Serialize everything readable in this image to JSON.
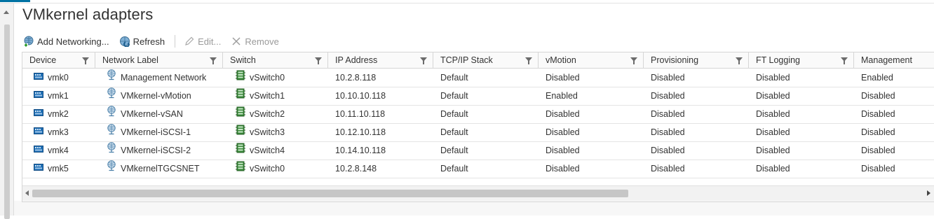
{
  "title": "VMkernel adapters",
  "toolbar": {
    "add_networking": "Add Networking...",
    "refresh": "Refresh",
    "edit": "Edit...",
    "remove": "Remove"
  },
  "columns": [
    "Device",
    "Network Label",
    "Switch",
    "IP Address",
    "TCP/IP Stack",
    "vMotion",
    "Provisioning",
    "FT Logging",
    "Management"
  ],
  "rows": [
    {
      "device": "vmk0",
      "label": "Management Network",
      "switch": "vSwitch0",
      "ip": "10.2.8.118",
      "stack": "Default",
      "vmotion": "Disabled",
      "provisioning": "Disabled",
      "ft": "Disabled",
      "management": "Enabled"
    },
    {
      "device": "vmk1",
      "label": "VMkernel-vMotion",
      "switch": "vSwitch1",
      "ip": "10.10.10.118",
      "stack": "Default",
      "vmotion": "Enabled",
      "provisioning": "Disabled",
      "ft": "Disabled",
      "management": "Disabled"
    },
    {
      "device": "vmk2",
      "label": "VMkernel-vSAN",
      "switch": "vSwitch2",
      "ip": "10.11.10.118",
      "stack": "Default",
      "vmotion": "Disabled",
      "provisioning": "Disabled",
      "ft": "Disabled",
      "management": "Disabled"
    },
    {
      "device": "vmk3",
      "label": "VMkernel-iSCSI-1",
      "switch": "vSwitch3",
      "ip": "10.12.10.118",
      "stack": "Default",
      "vmotion": "Disabled",
      "provisioning": "Disabled",
      "ft": "Disabled",
      "management": "Disabled"
    },
    {
      "device": "vmk4",
      "label": "VMkernel-iSCSI-2",
      "switch": "vSwitch4",
      "ip": "10.14.10.118",
      "stack": "Default",
      "vmotion": "Disabled",
      "provisioning": "Disabled",
      "ft": "Disabled",
      "management": "Disabled"
    },
    {
      "device": "vmk5",
      "label": "VMkernelTGCSNET",
      "switch": "vSwitch0",
      "ip": "10.2.8.148",
      "stack": "Default",
      "vmotion": "Disabled",
      "provisioning": "Disabled",
      "ft": "Disabled",
      "management": "Disabled"
    }
  ],
  "icons": {
    "add_networking": "add-network-icon",
    "refresh": "refresh-icon",
    "edit": "pencil-icon",
    "remove": "close-icon",
    "device": "nic-adapter-icon",
    "label": "network-globe-icon",
    "switch": "virtual-switch-icon",
    "filter": "filter-icon"
  },
  "colors": {
    "accent": "#0072a3",
    "device_icon": "#1f6fb5",
    "switch_icon": "#3a8a3a",
    "globe_icon": "#4a7fa8"
  }
}
